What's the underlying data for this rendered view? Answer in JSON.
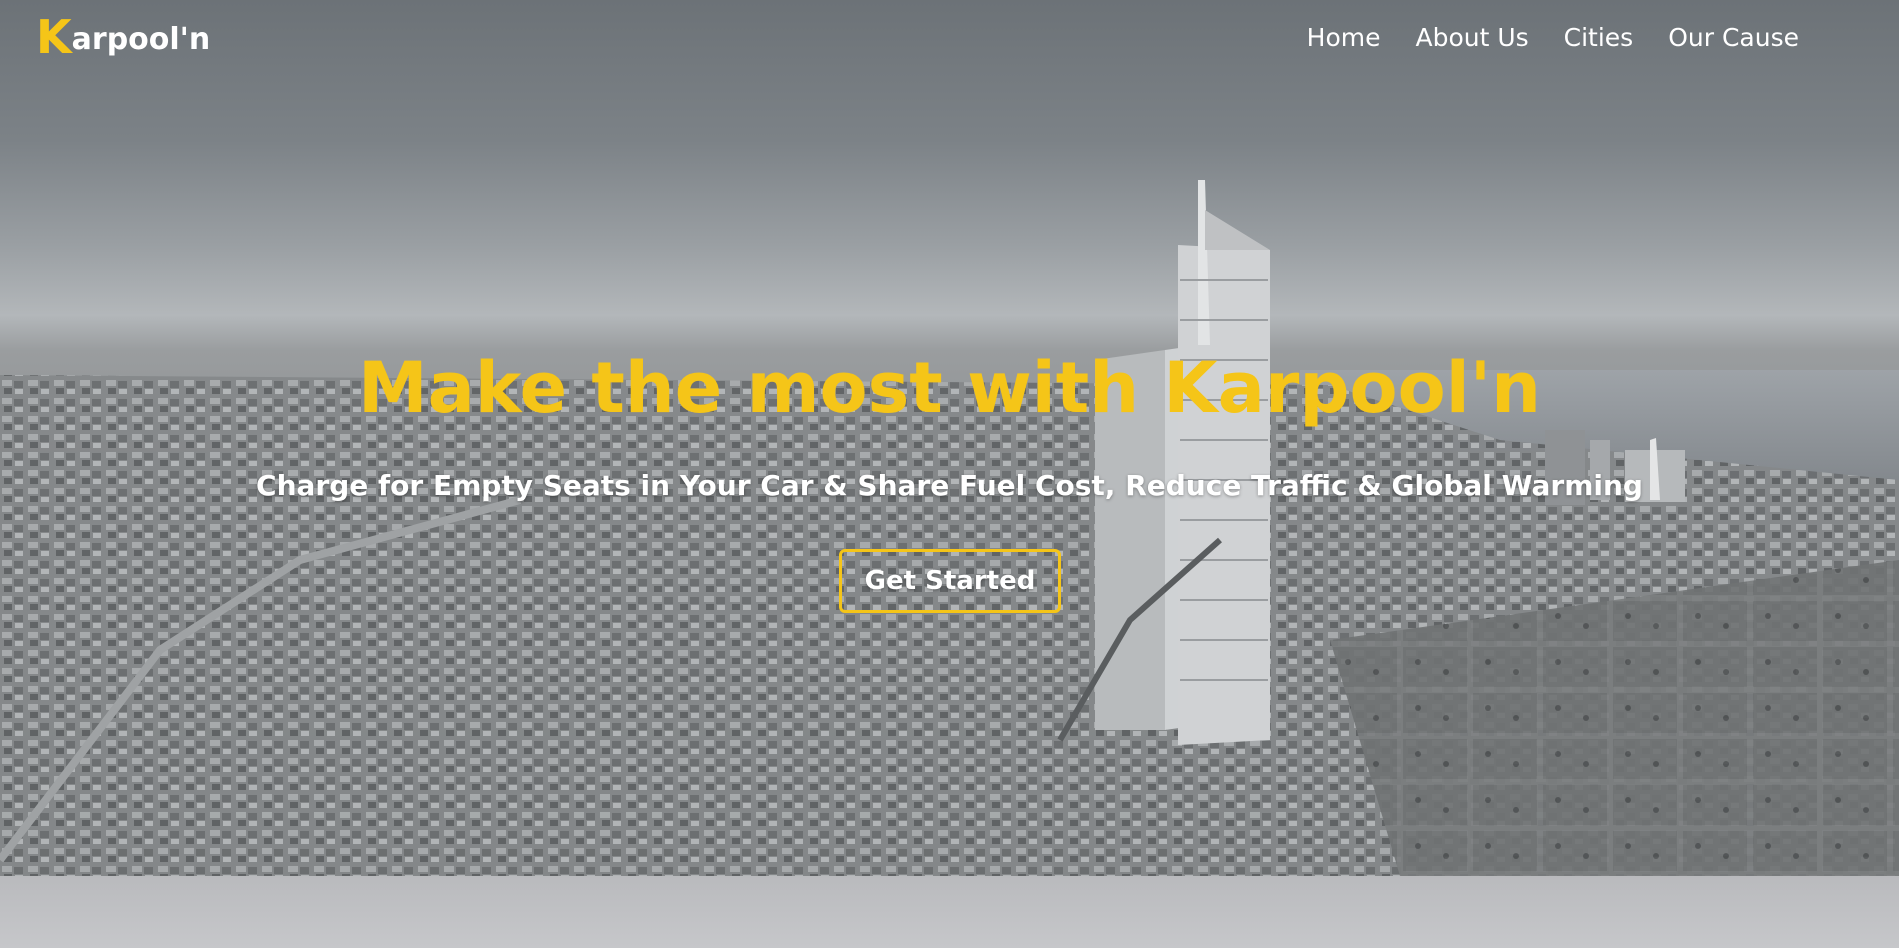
{
  "brand": {
    "logo_initial": "K",
    "logo_rest": "arpool'n",
    "accent_color": "#f5c518"
  },
  "nav": {
    "items": [
      {
        "label": "Home"
      },
      {
        "label": "About Us"
      },
      {
        "label": "Cities"
      },
      {
        "label": "Our Cause"
      }
    ]
  },
  "hero": {
    "background": "aerial-city-skyline-photo",
    "headline": "Make the most with Karpool'n",
    "subheadline": "Charge for Empty Seats in Your Car & Share Fuel Cost, Reduce Traffic & Global Warming",
    "cta_label": "Get Started"
  }
}
